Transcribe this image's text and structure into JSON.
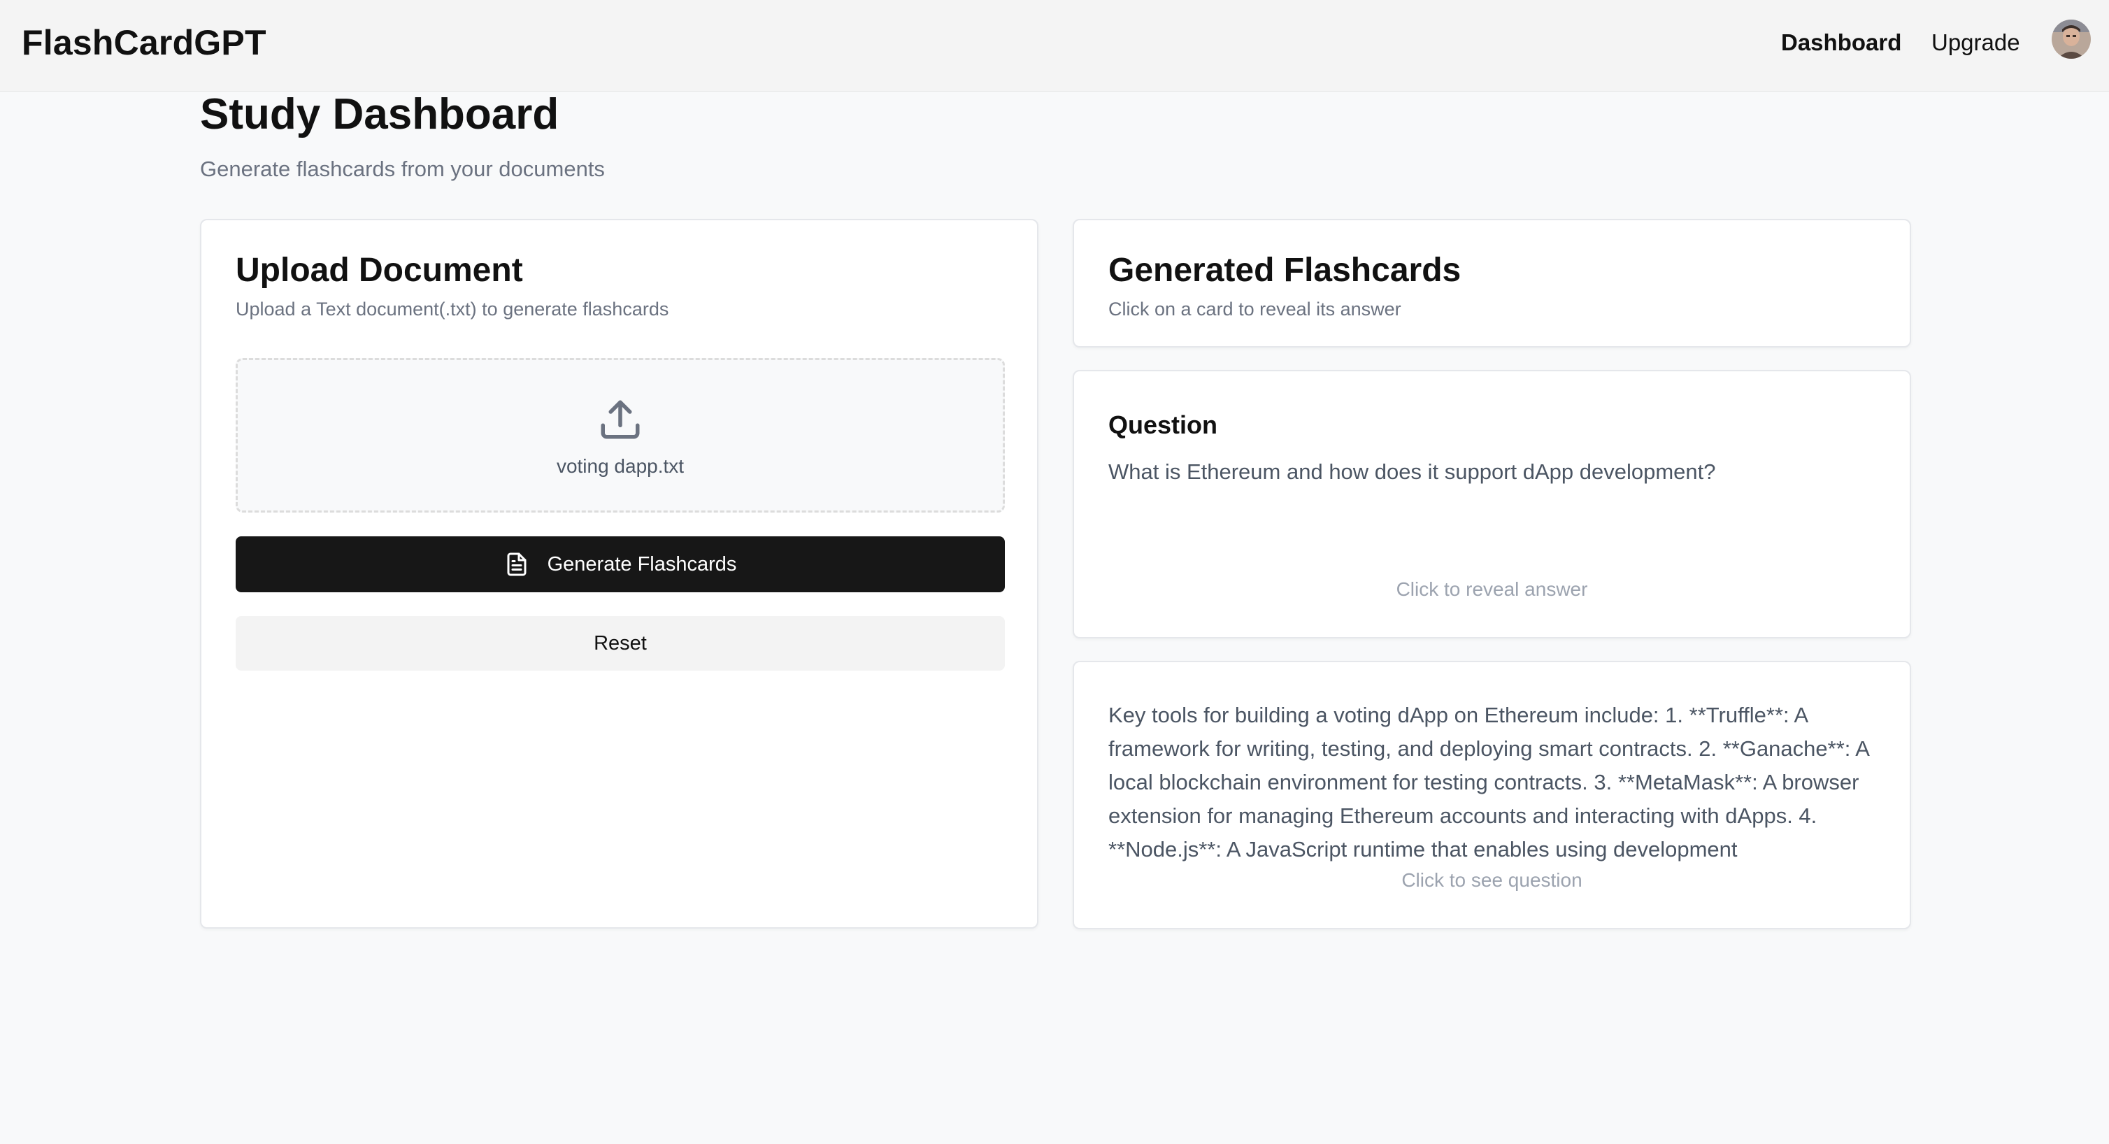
{
  "header": {
    "brand": "FlashCardGPT",
    "nav": {
      "dashboard": "Dashboard",
      "upgrade": "Upgrade"
    }
  },
  "page": {
    "title": "Study Dashboard",
    "subtitle": "Generate flashcards from your documents"
  },
  "upload": {
    "title": "Upload Document",
    "description": "Upload a Text document(.txt) to generate flashcards",
    "file_name": "voting dapp.txt",
    "generate_label": "Generate Flashcards",
    "reset_label": "Reset"
  },
  "flashcards": {
    "title": "Generated Flashcards",
    "description": "Click on a card to reveal its answer",
    "cards": [
      {
        "side": "question",
        "label": "Question",
        "text": "What is Ethereum and how does it support dApp development?",
        "hint": "Click to reveal answer"
      },
      {
        "side": "answer",
        "text": "Key tools for building a voting dApp on Ethereum include: 1. **Truffle**: A framework for writing, testing, and deploying smart contracts. 2. **Ganache**: A local blockchain environment for testing contracts. 3. **MetaMask**: A browser extension for managing Ethereum accounts and interacting with dApps. 4. **Node.js**: A JavaScript runtime that enables using development",
        "hint": "Click to see question"
      }
    ]
  },
  "colors": {
    "primary_button": "#171717",
    "secondary_button": "#f3f3f3",
    "muted_text": "#6b7280",
    "hint_text": "#9ca3af",
    "background": "#f8f9fa",
    "header_bg": "#f4f4f4"
  },
  "icons": {
    "upload": "upload-icon",
    "document": "document-icon",
    "avatar": "user-avatar"
  }
}
